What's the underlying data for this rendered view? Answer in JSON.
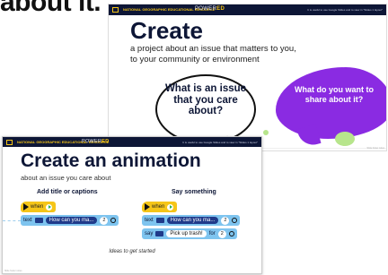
{
  "top_heading": "about it.",
  "slide_bar": {
    "org": "NATIONAL GEOGRAPHIC EDUCATIONAL RESOURCE",
    "program_prefix": "POWER",
    "program_suffix": "ED",
    "note": "It is useful to use Google Slides and to view in \"Slides 1 layout\""
  },
  "slide1": {
    "title": "Create",
    "subtitle": "a project about an issue that matters to you, to your community or environment",
    "question_bubble": "What is an issue that you care about?",
    "purple_bubble": "What do you want to share about it?",
    "footer": "Slide footer notes"
  },
  "slide2": {
    "title": "Create an animation",
    "subtitle": "about an issue you care about",
    "col_left_heading": "Add title or captions",
    "col_right_heading": "Say something",
    "when_label": "when",
    "text_label": "text",
    "say_label": "say",
    "for_label": "for",
    "caption_value": "How can you ma...",
    "caption_value_right": "How can you ma...",
    "say_value": "Pick up trash!",
    "seconds_left": "2",
    "seconds_right": "2",
    "seconds_say": "2",
    "ideas": "Ideas to get started",
    "footer": "Slide footer notes"
  },
  "colors": {
    "navy": "#0d1636",
    "yellow": "#f5c518",
    "purple": "#8a2be2",
    "green": "#b7e58c",
    "looks_blue": "#7ec4ef"
  }
}
